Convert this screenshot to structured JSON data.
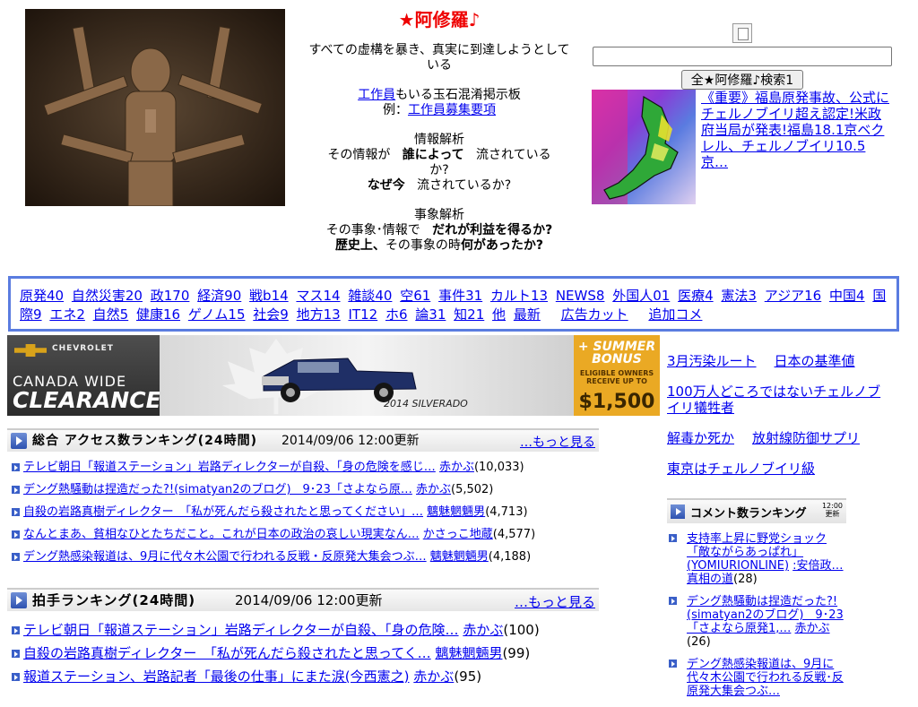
{
  "header": {
    "title": "★阿修羅♪",
    "tagline": "すべての虚構を暴き、真実に到達しようとしている",
    "board_link": "工作員",
    "board_text": "もいる玉石混淆掲示板",
    "example_prefix": "例：",
    "example_link": "工作員募集要項",
    "info_heading": "情報解析",
    "info_line1_a": "その情報が",
    "info_line1_b": "誰によって",
    "info_line1_c": "流されている",
    "info_line2": "か?",
    "info_line3_a": "なぜ今",
    "info_line3_b": "流されているか?",
    "event_heading": "事象解析",
    "event_line1_a": "その事象･情報で",
    "event_line1_b": "だれが利益を得るか?",
    "event_line2_a": "歴史上、",
    "event_line2_b": "その事象の時",
    "event_line2_c": "何があったか?"
  },
  "search": {
    "placeholder": "",
    "button_label": "全★阿修羅♪検索1"
  },
  "featured": {
    "link": "《重要》福島原発事故、公式にチェルノブイリ超え認定!米政府当局が発表!福島18.1京ベクレル、チェルノブイリ10.5京…"
  },
  "categories": [
    "原発40",
    "自然災害20",
    "政170",
    "経済90",
    "戦b14",
    "マス14",
    "雑談40",
    "空61",
    "事件31",
    "カルト13",
    "NEWS8",
    "外国人01",
    "医療4",
    "憲法3",
    "アジア16",
    "中国4",
    "国際9",
    "エネ2",
    "自然5",
    "健康16",
    "ゲノム15",
    "社会9",
    "地方13",
    "IT12",
    "ホ6",
    "論31",
    "知21",
    "他",
    "最新",
    "広告カット",
    "追加コメ"
  ],
  "ad": {
    "brand": "CHEVROLET",
    "headline1": "CANADA WIDE",
    "headline2": "CLEARANCE",
    "model": "2014 SILVERADO",
    "promo1": "+ SUMMER BONUS",
    "promo2": "ELIGIBLE OWNERS RECEIVE UP TO",
    "amount": "$1,500"
  },
  "right_links": [
    [
      "3月汚染ルート",
      "日本の基準値"
    ],
    [
      "100万人どころではないチェルノブイリ犠牲者"
    ],
    [
      "解毒か死か",
      "放射線防御サプリ"
    ],
    [
      "東京はチェルノブイリ級"
    ]
  ],
  "access_ranking": {
    "title": "総合 アクセス数ランキング(24時間)",
    "updated": "2014/09/06 12:00更新",
    "more": "…もっと見る",
    "items": [
      {
        "title": "テレビ朝日「報道ステーション」岩路ディレクターが自殺、「身の危険を感じ…",
        "author": "赤かぶ",
        "count": "(10,033)"
      },
      {
        "title": "デング熱騒動は捏造だった?!(simatyan2のブログ)　9･23「さよなら原…",
        "author": "赤かぶ",
        "count": "(5,502)"
      },
      {
        "title": "自殺の岩路真樹ディレクター　「私が死んだら殺されたと思ってください」…",
        "author": "魑魅魍魎男",
        "count": "(4,713)"
      },
      {
        "title": "なんとまあ、貧相なひとたちだこと。これが日本の政治の哀しい現実なん…",
        "author": "かさっこ地蔵",
        "count": "(4,577)"
      },
      {
        "title": "デング熱感染報道は、9月に代々木公園で行われる反戦・反原発大集会つぶ…",
        "author": "魑魅魍魎男",
        "count": "(4,188)"
      }
    ]
  },
  "clap_ranking": {
    "title": "拍手ランキング(24時間)",
    "updated": "2014/09/06 12:00更新",
    "more": "…もっと見る",
    "items": [
      {
        "title": "テレビ朝日「報道ステーション」岩路ディレクターが自殺、「身の危険…",
        "author": "赤かぶ",
        "count": "(100)"
      },
      {
        "title": "自殺の岩路真樹ディレクター　「私が死んだら殺されたと思ってく…",
        "author": "魑魅魍魎男",
        "count": "(99)"
      },
      {
        "title": "報道ステーション、岩路記者「最後の仕事」にまた涙(今西憲之)",
        "author": "赤かぶ",
        "count": "(95)"
      }
    ]
  },
  "comment_ranking": {
    "title": "コメント数ランキング",
    "time_line1": "12:00",
    "time_line2": "更新",
    "items": [
      {
        "title": "支持率上昇に野党ショック「敵ながらあっぱれ」(YOMIURIONLINE)",
        "author": ":安倍政… 真相の道",
        "count": "(28)"
      },
      {
        "title": "デング熱騒動は捏造だった?!(simatyan2のブログ)　9･23「さよなら原発1,…",
        "author": "赤かぶ",
        "count": "(26)"
      },
      {
        "title": "デング熱感染報道は、9月に代々木公園で行われる反戦･反原発大集会つぶ…",
        "author": "",
        "count": ""
      }
    ]
  }
}
